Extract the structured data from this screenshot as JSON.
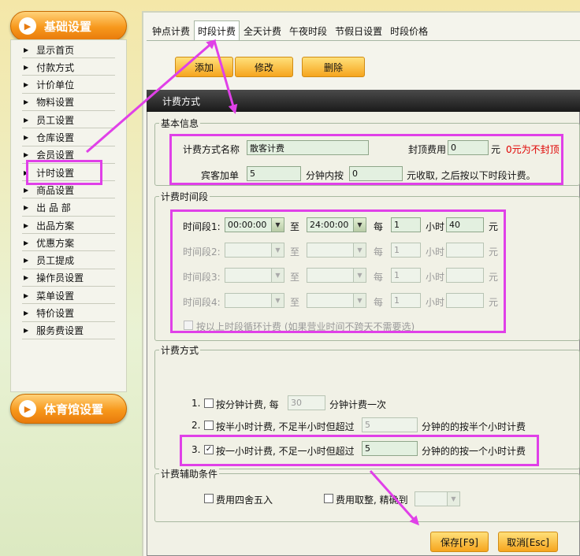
{
  "sidebar": {
    "header_top": "基础设置",
    "header_bottom": "体育馆设置",
    "items": [
      "显示首页",
      "付款方式",
      "计价单位",
      "物料设置",
      "员工设置",
      "仓库设置",
      "会员设置",
      "计时设置",
      "商品设置",
      "出 品 部",
      "出品方案",
      "优惠方案",
      "员工提成",
      "操作员设置",
      "菜单设置",
      "特价设置",
      "服务费设置"
    ]
  },
  "tabs": [
    "钟点计费",
    "时段计费",
    "全天计费",
    "午夜时段",
    "节假日设置",
    "时段价格"
  ],
  "active_tab": "时段计费",
  "toolbar": {
    "add": "添加",
    "edit": "修改",
    "delete": "删除"
  },
  "dialog": {
    "title": "计费方式",
    "basic": {
      "legend": "基本信息",
      "name_label": "计费方式名称",
      "name_value": "散客计费",
      "cap_label": "封顶费用",
      "cap_value": "0",
      "cap_unit": "元",
      "cap_note": "0元为不封顶",
      "guest_label": "宾客加单",
      "guest_value": "5",
      "within_label": "分钟内按",
      "within_value": "0",
      "after_label": "元收取, 之后按以下时段计费。"
    },
    "periods": {
      "legend": "计费时间段",
      "rows": [
        {
          "label": "时间段1:",
          "start": "00:00:00",
          "to": "至",
          "end": "24:00:00",
          "every": "每",
          "hours": "1",
          "hour_unit": "小时",
          "price": "40",
          "yuan": "元"
        },
        {
          "label": "时间段2:",
          "start": "",
          "to": "至",
          "end": "",
          "every": "每",
          "hours": "1",
          "hour_unit": "小时",
          "price": "",
          "yuan": "元"
        },
        {
          "label": "时间段3:",
          "start": "",
          "to": "至",
          "end": "",
          "every": "每",
          "hours": "1",
          "hour_unit": "小时",
          "price": "",
          "yuan": "元"
        },
        {
          "label": "时间段4:",
          "start": "",
          "to": "至",
          "end": "",
          "every": "每",
          "hours": "1",
          "hour_unit": "小时",
          "price": "",
          "yuan": "元"
        }
      ],
      "loop_label": "按以上时段循环计费 (如果营业时间不跨天不需要选)"
    },
    "method": {
      "legend": "计费方式",
      "opt1_num": "1.",
      "opt1_a": "按分钟计费, 每",
      "opt1_value": "30",
      "opt1_b": "分钟计费一次",
      "opt2_num": "2.",
      "opt2_a": "按半小时计费, 不足半小时但超过",
      "opt2_value": "5",
      "opt2_b": "分钟的的按半个小时计费",
      "opt3_num": "3.",
      "opt3_a": "按一小时计费, 不足一小时但超过",
      "opt3_value": "5",
      "opt3_b": "分钟的的按一个小时计费"
    },
    "aux": {
      "legend": "计费辅助条件",
      "round_label": "费用四舍五入",
      "trunc_label": "费用取整, 精确到",
      "trunc_value": ""
    },
    "save": "保存[F9]",
    "cancel": "取消[Esc]"
  },
  "colors": {
    "highlight": "#e040e8",
    "accent": "#f7981c",
    "note_red": "#e00000"
  }
}
